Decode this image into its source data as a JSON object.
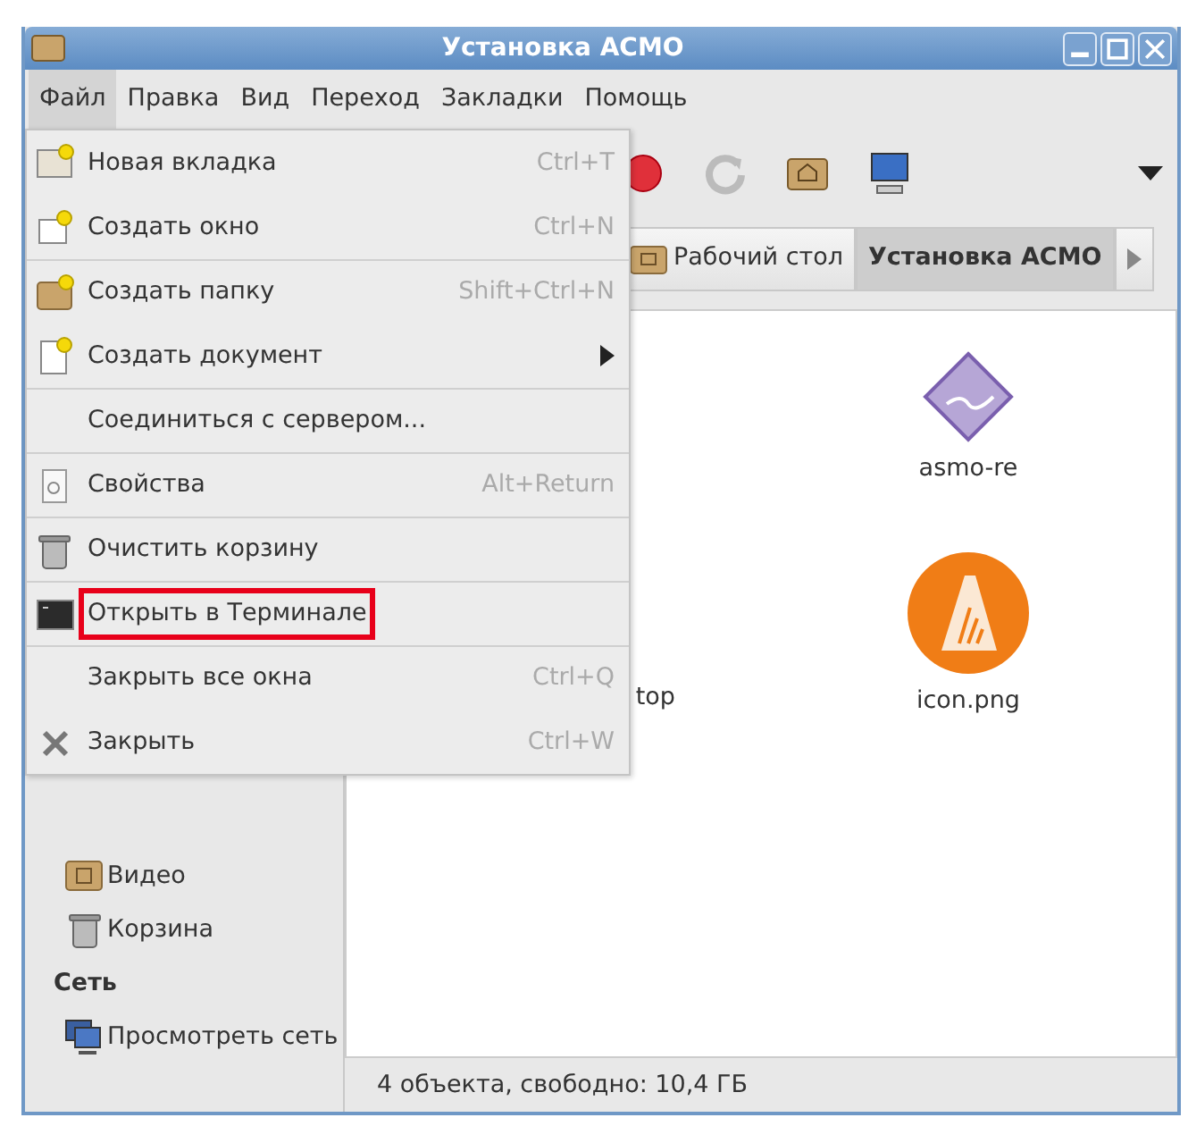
{
  "window": {
    "title": "Установка АСМО"
  },
  "menubar": [
    {
      "label": "Файл",
      "selected": true
    },
    {
      "label": "Правка",
      "selected": false
    },
    {
      "label": "Вид",
      "selected": false
    },
    {
      "label": "Переход",
      "selected": false
    },
    {
      "label": "Закладки",
      "selected": false
    },
    {
      "label": "Помощь",
      "selected": false
    }
  ],
  "file_menu": [
    {
      "label": "Новая вкладка",
      "shortcut": "Ctrl+T",
      "separator_before": false,
      "submenu": false,
      "highlighted": false
    },
    {
      "label": "Создать окно",
      "shortcut": "Ctrl+N",
      "separator_before": false,
      "submenu": false,
      "highlighted": false
    },
    {
      "label": "Создать папку",
      "shortcut": "Shift+Ctrl+N",
      "separator_before": true,
      "submenu": false,
      "highlighted": false
    },
    {
      "label": "Создать документ",
      "separator_before": false,
      "submenu": true,
      "highlighted": false
    },
    {
      "label": "Соединиться с сервером...",
      "separator_before": true,
      "submenu": false,
      "highlighted": false
    },
    {
      "label": "Свойства",
      "shortcut": "Alt+Return",
      "separator_before": true,
      "submenu": false,
      "highlighted": false
    },
    {
      "label": "Очистить корзину",
      "separator_before": true,
      "submenu": false,
      "highlighted": false
    },
    {
      "label": "Открыть в Терминале",
      "separator_before": true,
      "submenu": false,
      "highlighted": true
    },
    {
      "label": "Закрыть все окна",
      "shortcut": "Ctrl+Q",
      "separator_before": true,
      "submenu": false,
      "highlighted": false
    },
    {
      "label": "Закрыть",
      "shortcut": "Ctrl+W",
      "separator_before": false,
      "submenu": false,
      "highlighted": false
    }
  ],
  "breadcrumbs": [
    {
      "label": "Рабочий стол",
      "selected": false
    },
    {
      "label": "Установка АСМО",
      "selected": true
    }
  ],
  "sidebar": [
    {
      "kind": "item",
      "label": "Видео"
    },
    {
      "kind": "item",
      "label": "Корзина"
    },
    {
      "kind": "heading",
      "label": "Сеть"
    },
    {
      "kind": "item",
      "label": "Просмотреть сеть"
    }
  ],
  "files": [
    {
      "label": "asmo-re"
    },
    {
      "label": "top"
    },
    {
      "label": "icon.png"
    }
  ],
  "status_bar": "4 объекта, свободно: 10,4 ГБ"
}
